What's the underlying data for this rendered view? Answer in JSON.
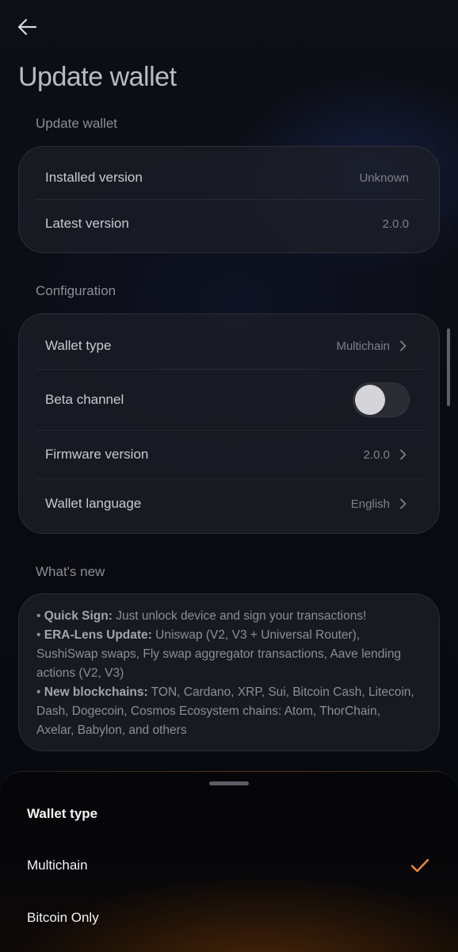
{
  "page": {
    "title": "Update wallet"
  },
  "update_section": {
    "label": "Update wallet",
    "rows": [
      {
        "label": "Installed version",
        "value": "Unknown"
      },
      {
        "label": "Latest version",
        "value": "2.0.0"
      }
    ]
  },
  "configuration_section": {
    "label": "Configuration",
    "wallet_type": {
      "label": "Wallet type",
      "value": "Multichain"
    },
    "beta_channel": {
      "label": "Beta channel",
      "enabled": false
    },
    "firmware_version": {
      "label": "Firmware version",
      "value": "2.0.0"
    },
    "wallet_language": {
      "label": "Wallet language",
      "value": "English"
    }
  },
  "whats_new": {
    "label": "What's new",
    "items": [
      {
        "bullet": "•",
        "title": "Quick Sign:",
        "text": "Just unlock device and sign your transactions!"
      },
      {
        "bullet": "•",
        "title": "ERA-Lens Update:",
        "text": "Uniswap (V2, V3 + Universal Router), SushiSwap swaps, Fly swap aggregator transactions, Aave lending actions (V2, V3)"
      },
      {
        "bullet": "•",
        "title": "New blockchains:",
        "text": "TON, Cardano, XRP, Sui, Bitcoin Cash, Litecoin, Dash, Dogecoin, Cosmos Ecosystem chains: Atom, ThorChain, Axelar, Babylon, and others"
      }
    ]
  },
  "sheet": {
    "title": "Wallet type",
    "options": [
      {
        "label": "Multichain",
        "selected": true
      },
      {
        "label": "Bitcoin Only",
        "selected": false
      }
    ]
  },
  "colors": {
    "accent": "#f08a3c",
    "background": "#0a0c12",
    "card": "#1c1e26"
  },
  "icons": {
    "back": "arrow-left-icon",
    "chevron": "chevron-right-icon",
    "check": "checkmark-icon"
  }
}
